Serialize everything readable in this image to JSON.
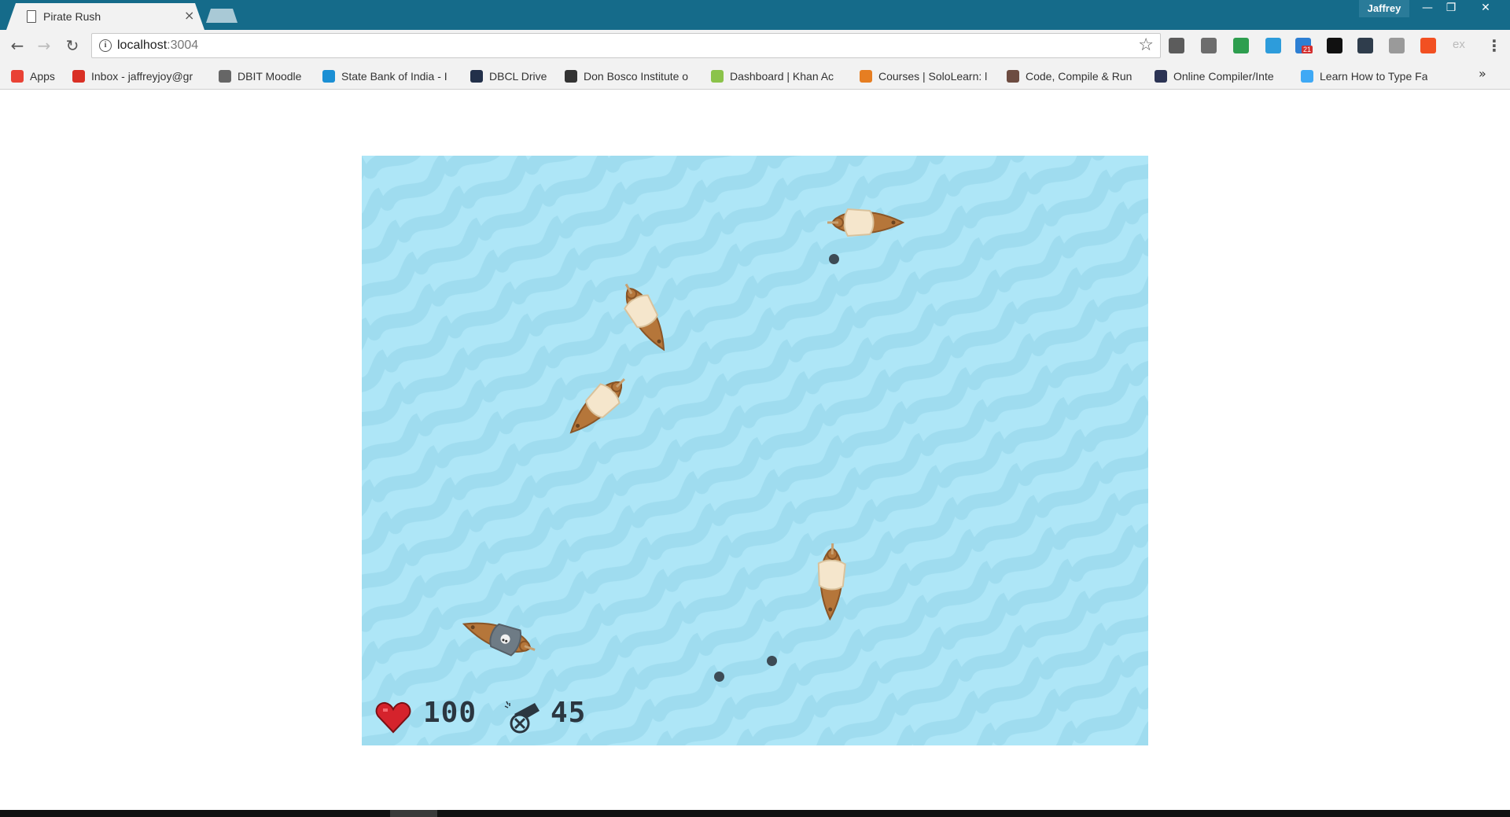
{
  "browser": {
    "tab_title": "Pirate Rush",
    "tab_close": "×",
    "profile_name": "Jaffrey",
    "url_host": "localhost",
    "url_port": ":3004",
    "menu_glyph": "⋮",
    "bookmarks_more": "»",
    "extensions": [
      {
        "icon": "pocket-icon",
        "color": "#5c5c5c"
      },
      {
        "icon": "evernote-icon",
        "color": "#6d6d6d"
      },
      {
        "icon": "eyedropper-icon",
        "color": "#2e9e4f"
      },
      {
        "icon": "window-icon",
        "color": "#2d9cdb"
      },
      {
        "icon": "todo-icon",
        "color": "#2d7fd3"
      },
      {
        "icon": "code-icon",
        "color": "#111111"
      },
      {
        "icon": "dots-icon",
        "color": "#2f3d4c"
      },
      {
        "icon": "settings-icon",
        "color": "#9a9a9a"
      },
      {
        "icon": "percent-icon",
        "color": "#f25022"
      },
      {
        "icon": "ex-icon",
        "color": "#cccccc"
      }
    ],
    "todo_badge": "21",
    "ex_label": "ex"
  },
  "bookmarks": [
    {
      "label": "Apps",
      "icon": "apps-grid-icon",
      "color": "#e94235"
    },
    {
      "label": "Inbox - jaffreyjoy@gr",
      "icon": "gmail-icon",
      "color": "#d93025"
    },
    {
      "label": "DBIT Moodle",
      "icon": "moodle-icon",
      "color": "#666666"
    },
    {
      "label": "State Bank of India - I",
      "icon": "sbi-icon",
      "color": "#1b8fd4"
    },
    {
      "label": "DBCL Drive",
      "icon": "cloud-icon",
      "color": "#22304a"
    },
    {
      "label": "Don Bosco Institute o",
      "icon": "dbit-icon",
      "color": "#333333"
    },
    {
      "label": "Dashboard | Khan Ac",
      "icon": "khan-icon",
      "color": "#8bc34a"
    },
    {
      "label": "Courses | SoloLearn: l",
      "icon": "sololearn-icon",
      "color": "#e67e22"
    },
    {
      "label": "Code, Compile & Run",
      "icon": "codechef-icon",
      "color": "#6d4c41"
    },
    {
      "label": "Online Compiler/Inte",
      "icon": "hackerearth-icon",
      "color": "#2c3454"
    },
    {
      "label": "Learn How to Type Fa",
      "icon": "typing-icon",
      "color": "#3fa9f5"
    }
  ],
  "game": {
    "health": "100",
    "ammo": "45",
    "colors": {
      "sea": "#aee6f7",
      "wave": "#9fdcef",
      "hull": "#b5763a",
      "sail": "#f5e6cc",
      "player_sail": "#6e7b85",
      "cannonball": "#3d4b55",
      "heart": "#d5232c"
    }
  }
}
